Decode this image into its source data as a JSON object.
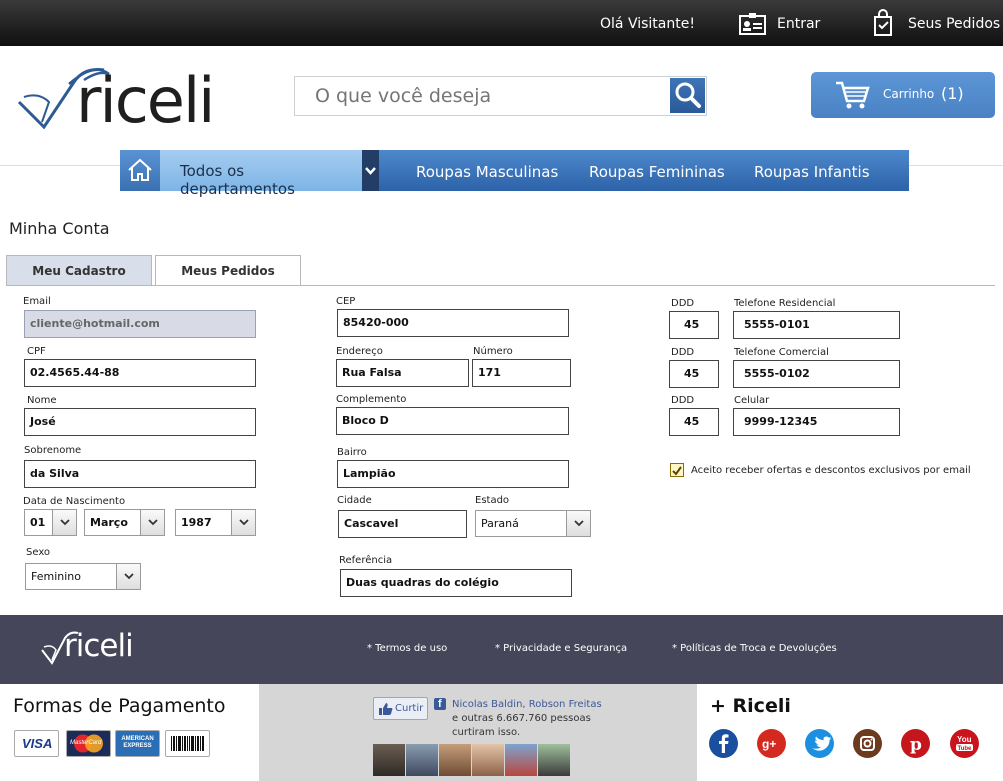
{
  "topbar": {
    "greeting": "Olá Visitante!",
    "login": "Entrar",
    "orders": "Seus Pedidos"
  },
  "brand": {
    "name": "riceli"
  },
  "search": {
    "placeholder": "O que você deseja"
  },
  "cart": {
    "label": "Carrinho",
    "count": "(1)"
  },
  "nav": {
    "departments": "Todos os departamentos",
    "items": [
      "Roupas Masculinas",
      "Roupas Femininas",
      "Roupas Infantis"
    ]
  },
  "page": {
    "title": "Minha Conta"
  },
  "tabs": [
    "Meu Cadastro",
    "Meus Pedidos"
  ],
  "form": {
    "email": {
      "label": "Email",
      "value": "cliente@hotmail.com"
    },
    "cpf": {
      "label": "CPF",
      "value": "02.4565.44-88"
    },
    "nome": {
      "label": "Nome",
      "value": "José"
    },
    "sobrenome": {
      "label": "Sobrenome",
      "value": "da Silva"
    },
    "nascimento": {
      "label": "Data de Nascimento",
      "day": "01",
      "month": "Março",
      "year": "1987"
    },
    "sexo": {
      "label": "Sexo",
      "value": "Feminino"
    },
    "cep": {
      "label": "CEP",
      "value": "85420-000"
    },
    "endereco": {
      "label": "Endereço",
      "value": "Rua Falsa"
    },
    "numero": {
      "label": "Número",
      "value": "171"
    },
    "complemento": {
      "label": "Complemento",
      "value": "Bloco D"
    },
    "bairro": {
      "label": "Bairro",
      "value": "Lampião"
    },
    "cidade": {
      "label": "Cidade",
      "value": "Cascavel"
    },
    "estado": {
      "label": "Estado",
      "value": "Paraná"
    },
    "referencia": {
      "label": "Referência",
      "value": "Duas quadras do colégio"
    },
    "ddd_label": "DDD",
    "tel_res": {
      "label": "Telefone Residencial",
      "ddd": "45",
      "value": "5555-0101"
    },
    "tel_com": {
      "label": "Telefone Comercial",
      "ddd": "45",
      "value": "5555-0102"
    },
    "celular": {
      "label": "Celular",
      "ddd": "45",
      "value": "9999-12345"
    },
    "optin": "Aceito receber ofertas e descontos exclusivos por email"
  },
  "footer": {
    "links": [
      "* Termos de uso",
      "* Privacidade e Segurança",
      "* Políticas de Troca e Devoluções"
    ],
    "payment_title": "Formas de Pagamento",
    "cards": [
      "VISA",
      "MasterCard",
      "AMERICAN EXPRESS",
      "boleto"
    ],
    "facebook": {
      "like": "Curtir",
      "names": "Nicolas Baldin, Robson Freitas",
      "line2": "e outras 6.667.760 pessoas",
      "line3": "curtiram isso."
    },
    "social_title": "+ Riceli",
    "social": [
      "facebook",
      "google-plus",
      "twitter",
      "instagram",
      "pinterest",
      "youtube"
    ]
  },
  "colors": {
    "topbar": "#1a1a1a",
    "accent_blue": "#3d75bd",
    "footer": "#46465a"
  }
}
